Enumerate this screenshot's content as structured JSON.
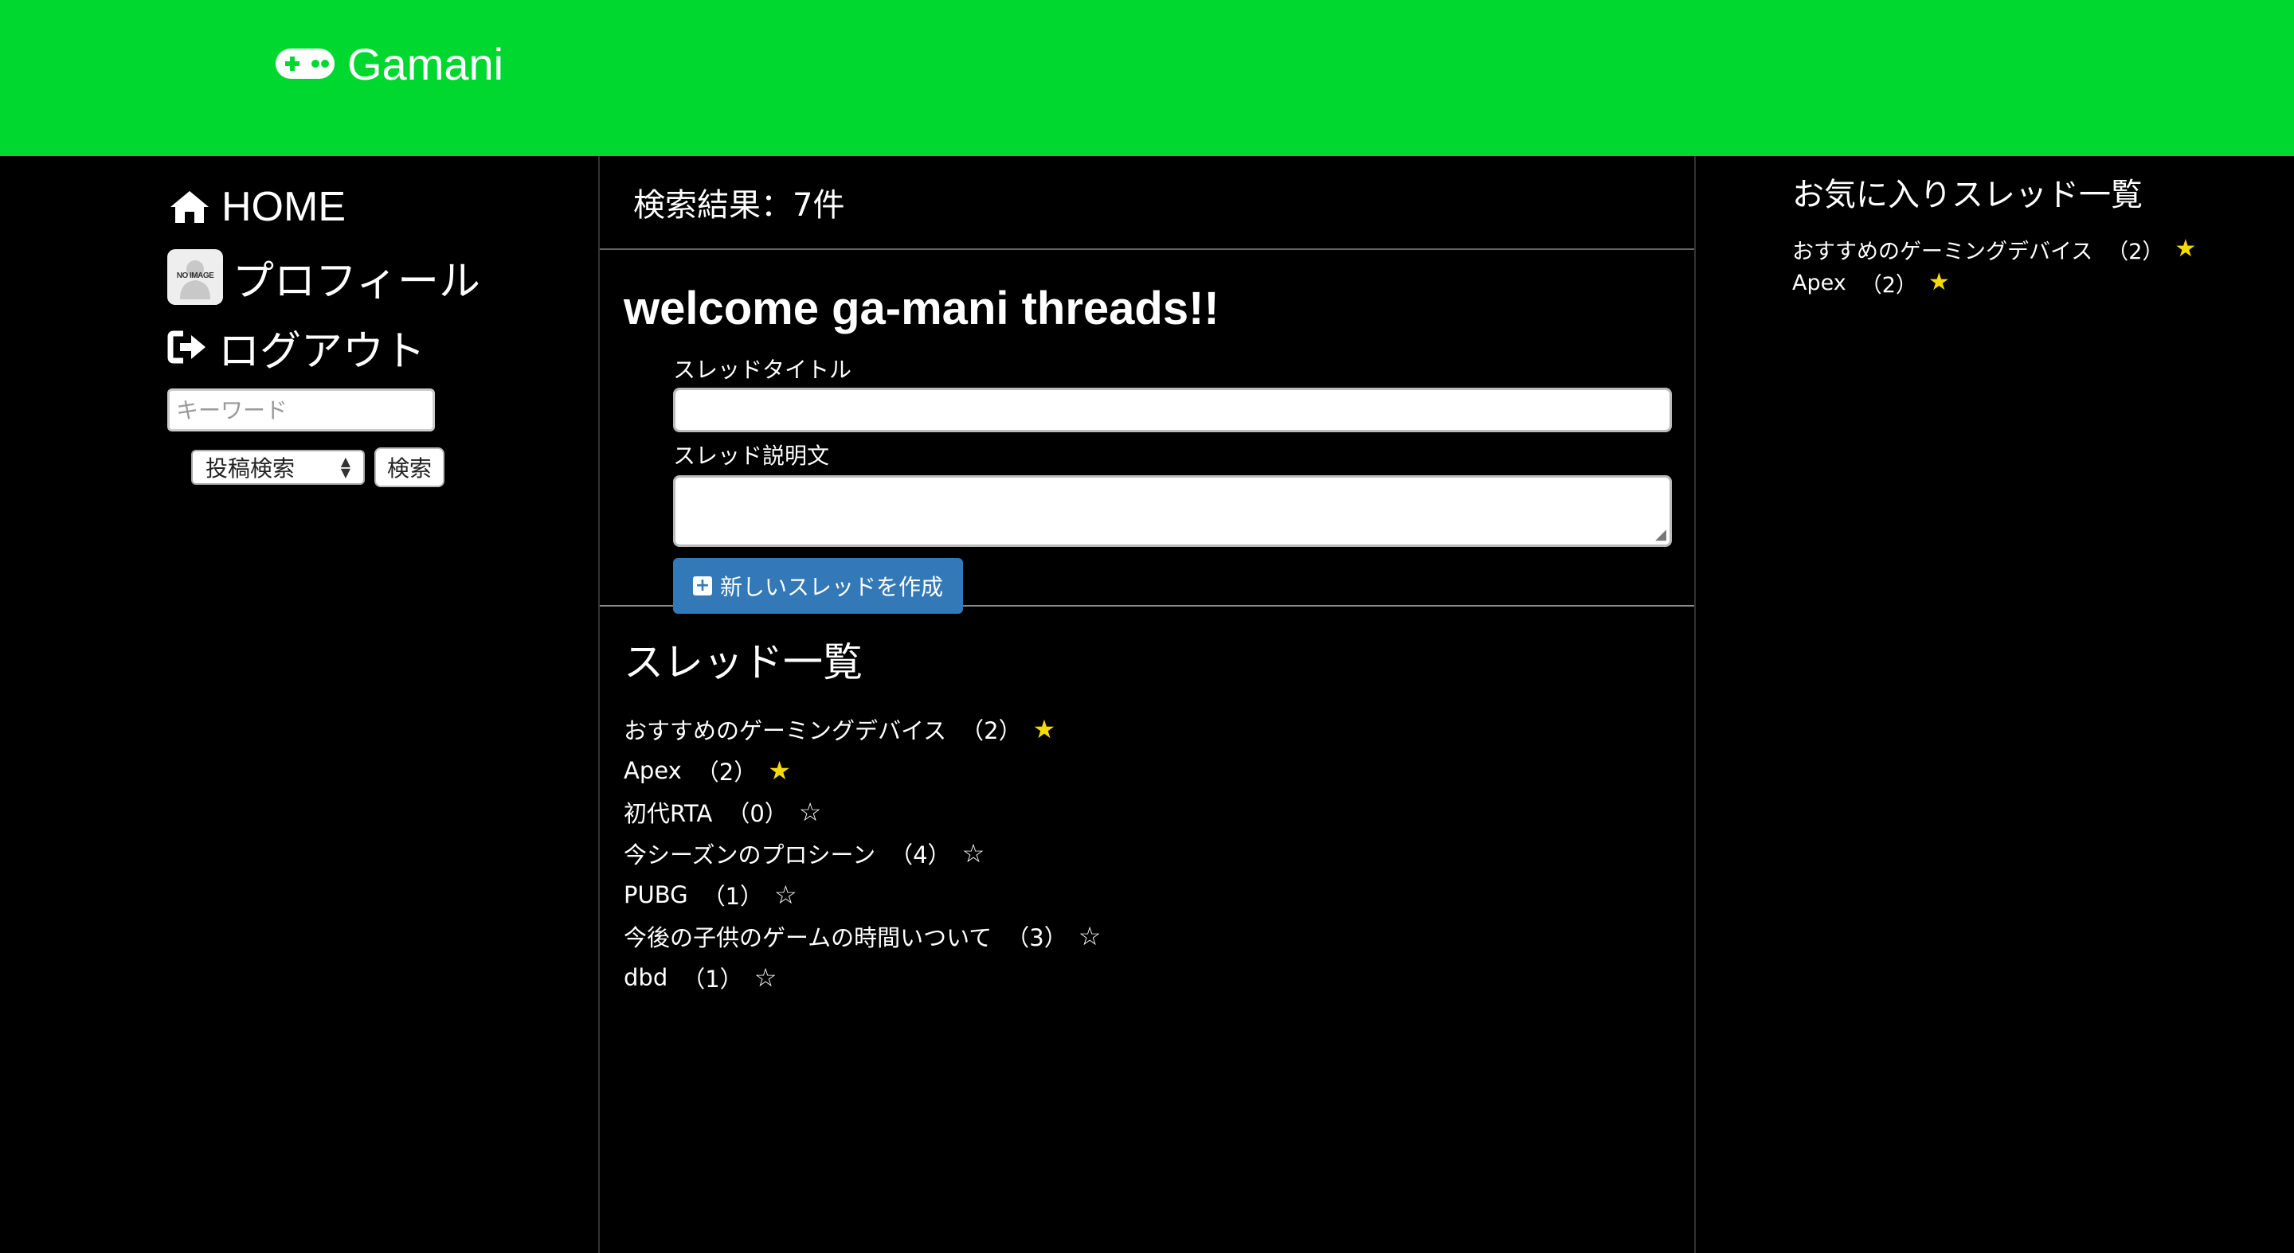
{
  "header": {
    "brand": "Gamani"
  },
  "nav": {
    "home": "HOME",
    "profile": "プロフィール",
    "avatar_text": "NO IMAGE",
    "logout": "ログアウト",
    "search_placeholder": "キーワード",
    "search_type": "投稿検索",
    "search_button": "検索"
  },
  "main": {
    "results": "検索結果：7件",
    "welcome": "welcome ga-mani threads!!",
    "title_label": "スレッドタイトル",
    "desc_label": "スレッド説明文",
    "create_button": "新しいスレッドを作成",
    "thread_heading": "スレッド一覧",
    "threads": [
      {
        "title": "おすすめのゲーミングデバイス",
        "count": "（2）",
        "favorite": true
      },
      {
        "title": "Apex",
        "count": "（2）",
        "favorite": true
      },
      {
        "title": "初代RTA",
        "count": "（0）",
        "favorite": false
      },
      {
        "title": "今シーズンのプロシーン",
        "count": "（4）",
        "favorite": false
      },
      {
        "title": "PUBG",
        "count": "（1）",
        "favorite": false
      },
      {
        "title": "今後の子供のゲームの時間いついて",
        "count": "（3）",
        "favorite": false
      },
      {
        "title": "dbd",
        "count": "（1）",
        "favorite": false
      }
    ]
  },
  "favorites": {
    "heading": "お気に入りスレッド一覧",
    "items": [
      {
        "title": "おすすめのゲーミングデバイス",
        "count": "（2）"
      },
      {
        "title": "Apex",
        "count": "（2）"
      }
    ]
  },
  "colors": {
    "header_bg": "#00d830",
    "button_blue": "#3379b7",
    "star_on": "#f5d90a"
  }
}
